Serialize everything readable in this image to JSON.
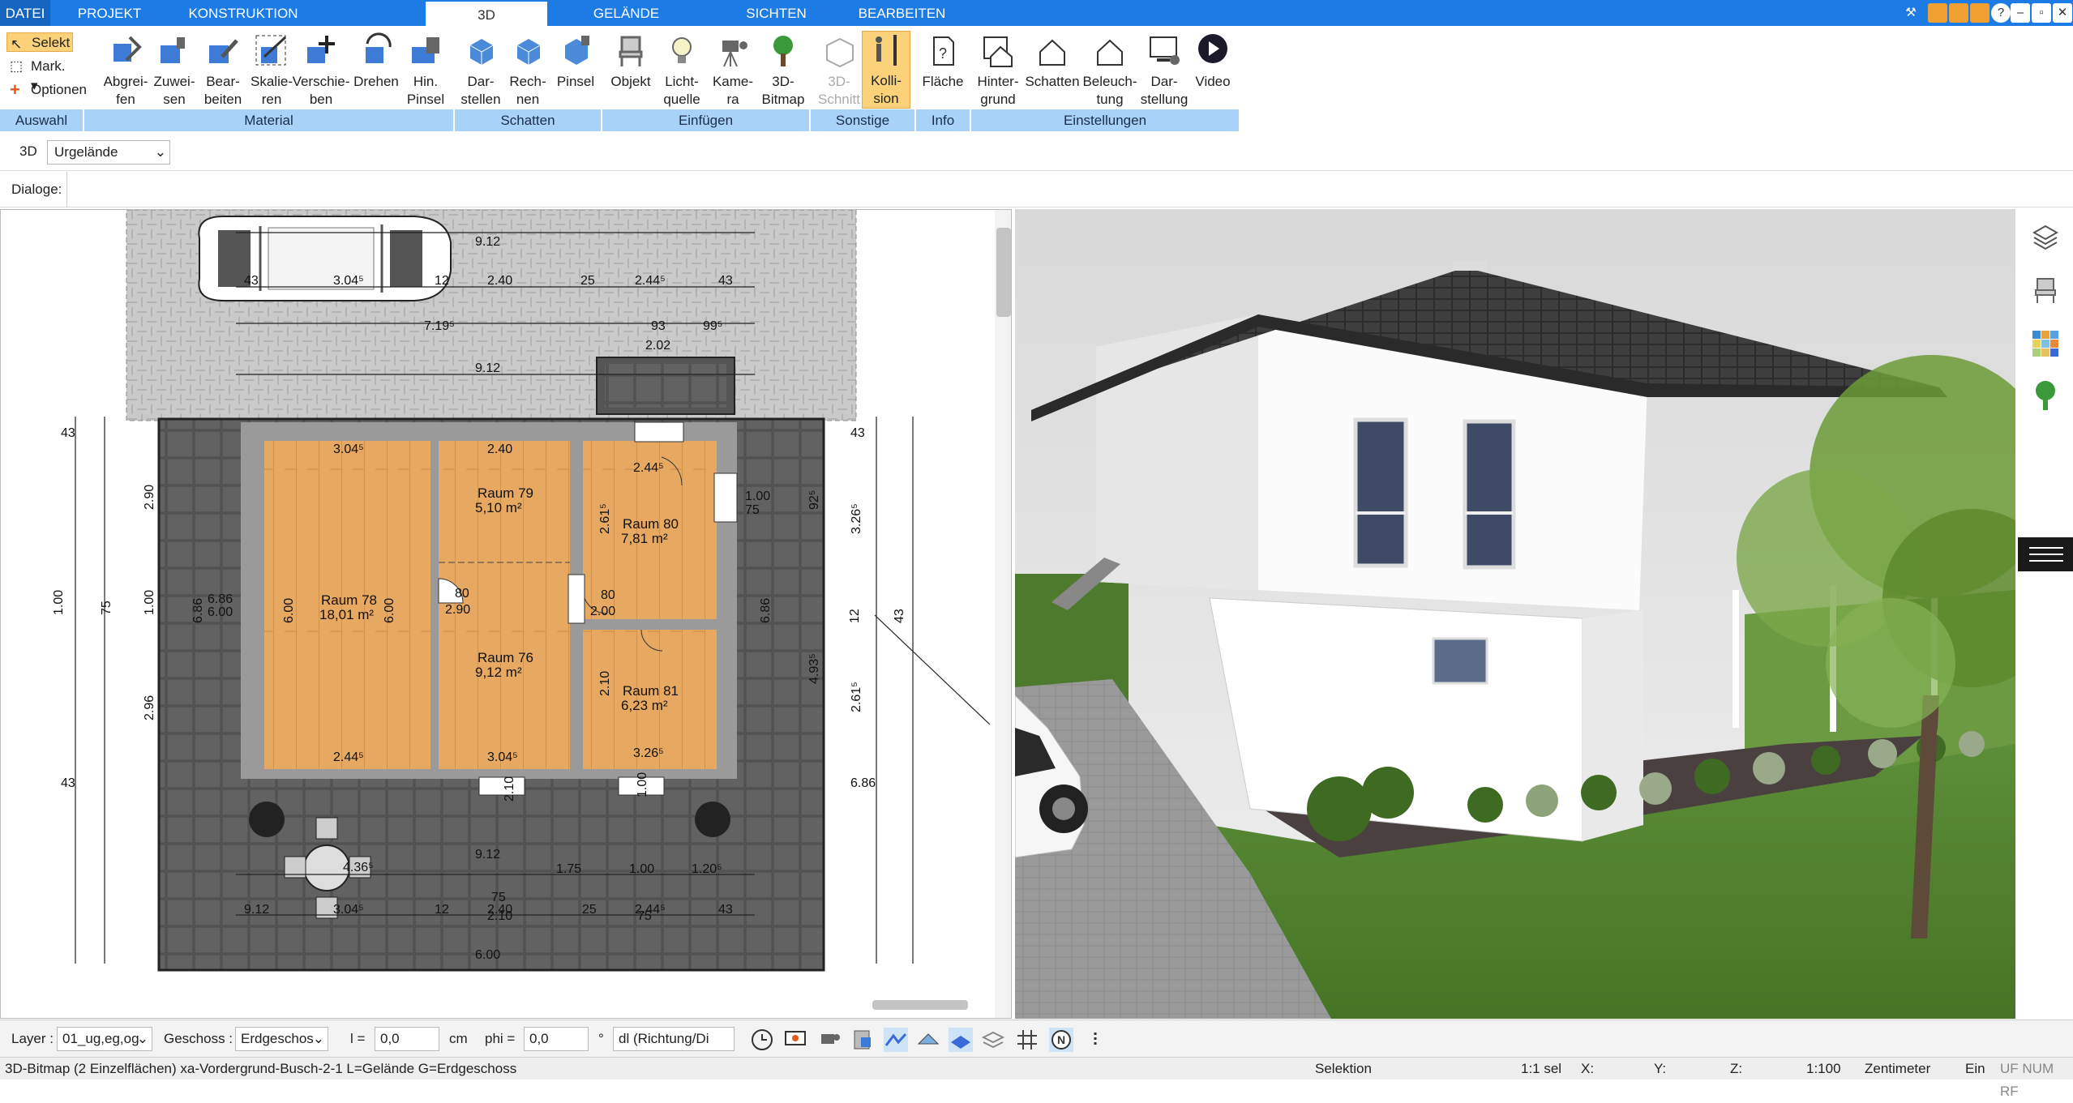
{
  "tabs": [
    "DATEI",
    "PROJEKT",
    "KONSTRUKTION",
    "3D",
    "GELÄNDE",
    "SICHTEN",
    "BEARBEITEN"
  ],
  "active_tab": "3D",
  "auswahl": {
    "select": "Selekt",
    "mark": "Mark.",
    "options": "Optionen"
  },
  "ribbon_buttons": {
    "abgreifen": "Abgrei-\nfen",
    "zuweisen": "Zuwei-\nsen",
    "bearbeiten": "Bear-\nbeiten",
    "skalieren": "Skalie-\nren",
    "verschieben": "Verschie-\nben",
    "drehen": "Drehen",
    "hinpinsel": "Hin.\nPinsel",
    "darstellen": "Dar-\nstellen",
    "rechnen": "Rech-\nnen",
    "pinsel": "Pinsel",
    "objekt": "Objekt",
    "lichtquelle": "Licht-\nquelle",
    "kamera": "Kame-\nra",
    "bitmap3d": "3D-\nBitmap",
    "schnitt3d": "3D-\nSchnitt",
    "kollision": "Kolli-\nsion",
    "flaeche": "Fläche",
    "hintergrund": "Hinter-\ngrund",
    "schatten": "Schatten",
    "beleuchtung": "Beleuch-\ntung",
    "darstellung": "Dar-\nstellung",
    "video": "Video"
  },
  "groups": [
    "Auswahl",
    "Material",
    "Schatten",
    "Einfügen",
    "Sonstige",
    "Info",
    "Einstellungen"
  ],
  "view_toolbar": {
    "mode": "3D",
    "terrain": "Urgelände"
  },
  "dialoge_label": "Dialoge:",
  "plan": {
    "dims": [
      "9.12",
      "2.40",
      "25",
      "2.44⁵",
      "43",
      "3.04⁵",
      "12",
      "43",
      "7.19⁵",
      "93",
      "99⁵",
      "2.02",
      "9.12",
      "43",
      "2.90",
      "1.00",
      "75",
      "6.86",
      "6.00",
      "1.00",
      "2.96",
      "43",
      "43",
      "92⁵",
      "1.00",
      "75",
      "3.26⁵",
      "12",
      "4.93⁵",
      "2.61⁵",
      "43",
      "6.86",
      "6.86",
      "80",
      "2.00",
      "80",
      "2.90",
      "9.12",
      "2.10",
      "1.00",
      "75",
      "80",
      "1.75",
      "1.00",
      "1.20⁵",
      "2.10",
      "75",
      "4.36⁵",
      "3.04⁵",
      "12",
      "2.40",
      "25",
      "2.44⁵",
      "43",
      "9.12",
      "6.00",
      "6.00",
      "6.00",
      "2.40",
      "2.40",
      "3.04⁵",
      "3.04⁵",
      "2.44⁵",
      "2.44⁵",
      "3.26⁵",
      "2.61⁵",
      "2.10",
      "2.10",
      "3.26⁵",
      "2.61⁵",
      "2.02"
    ],
    "rooms": [
      {
        "name": "Raum 78",
        "area": "18,01 m²"
      },
      {
        "name": "Raum 79",
        "area": "5,10 m²"
      },
      {
        "name": "Raum 76",
        "area": "9,12 m²"
      },
      {
        "name": "Raum 80",
        "area": "7,81 m²"
      },
      {
        "name": "Raum 81",
        "area": "6,23 m²"
      }
    ],
    "car_dim": "3.04⁵"
  },
  "bottom": {
    "layer_label": "Layer :",
    "layer_value": "01_ug,eg,og",
    "geschoss_label": "Geschoss :",
    "geschoss_value": "Erdgeschos",
    "l_label": "l =",
    "l_value": "0,0",
    "l_unit": "cm",
    "phi_label": "phi =",
    "phi_value": "0,0",
    "phi_unit": "°",
    "dir_value": "dl (Richtung/Di"
  },
  "status": {
    "text": "3D-Bitmap (2 Einzelflächen) xa-Vordergrund-Busch-2-1 L=Gelände G=Erdgeschoss",
    "mode": "Selektion",
    "sel": "1:1 sel",
    "x": "X:",
    "y": "Y:",
    "z": "Z:",
    "scale": "1:100",
    "unit": "Zentimeter",
    "ein": "Ein",
    "flags": "UF NUM RF"
  },
  "colors": {
    "ribbon_blue": "#1d7be6",
    "group_bar": "#a8d2f7",
    "floor": "#e8a960",
    "paving": "#555555",
    "lawn": "#4f8a2e",
    "roof": "#3a3a3a"
  }
}
